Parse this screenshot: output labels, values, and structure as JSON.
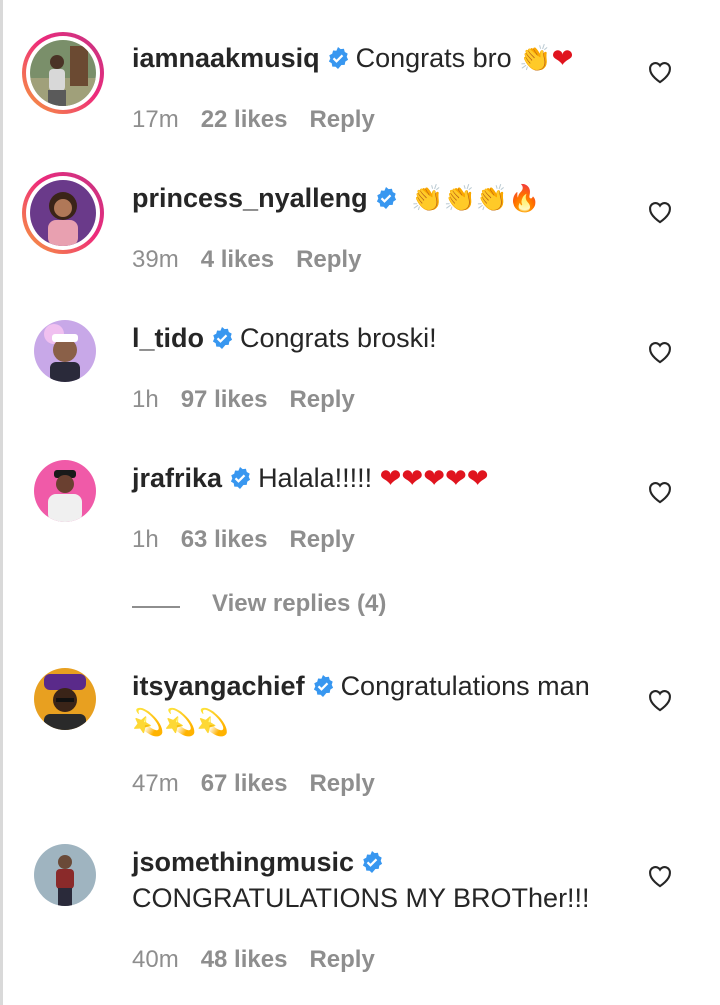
{
  "comments": [
    {
      "username": "iamnaakmusiq",
      "text": "Congrats bro",
      "emojis": "👏❤",
      "time": "17m",
      "likes": "22 likes",
      "reply": "Reply"
    },
    {
      "username": "princess_nyalleng",
      "text": "",
      "emojis": "👏👏👏🔥",
      "time": "39m",
      "likes": "4 likes",
      "reply": "Reply"
    },
    {
      "username": "l_tido",
      "text": "Congrats broski!",
      "emojis": "",
      "time": "1h",
      "likes": "97 likes",
      "reply": "Reply"
    },
    {
      "username": "jrafrika",
      "text": "Halala!!!!!",
      "emojis": "❤❤❤❤❤",
      "time": "1h",
      "likes": "63 likes",
      "reply": "Reply"
    },
    {
      "username": "itsyangachief",
      "text": "Congratulations man",
      "emojis": "💫💫💫",
      "time": "47m",
      "likes": "67 likes",
      "reply": "Reply"
    },
    {
      "username": "jsomethingmusic",
      "text": "CONGRATULATIONS MY BROTher!!!",
      "emojis": "",
      "time": "40m",
      "likes": "48 likes",
      "reply": "Reply"
    }
  ],
  "view_replies": "View replies (4)",
  "icons": {
    "verified": "verified-badge-icon",
    "like": "heart-outline-icon"
  },
  "colors": {
    "verified_blue": "#3897f0",
    "meta_gray": "#8e8e8e",
    "text": "#262626",
    "story_ring_start": "#f7a23a",
    "story_ring_end": "#c13584"
  }
}
